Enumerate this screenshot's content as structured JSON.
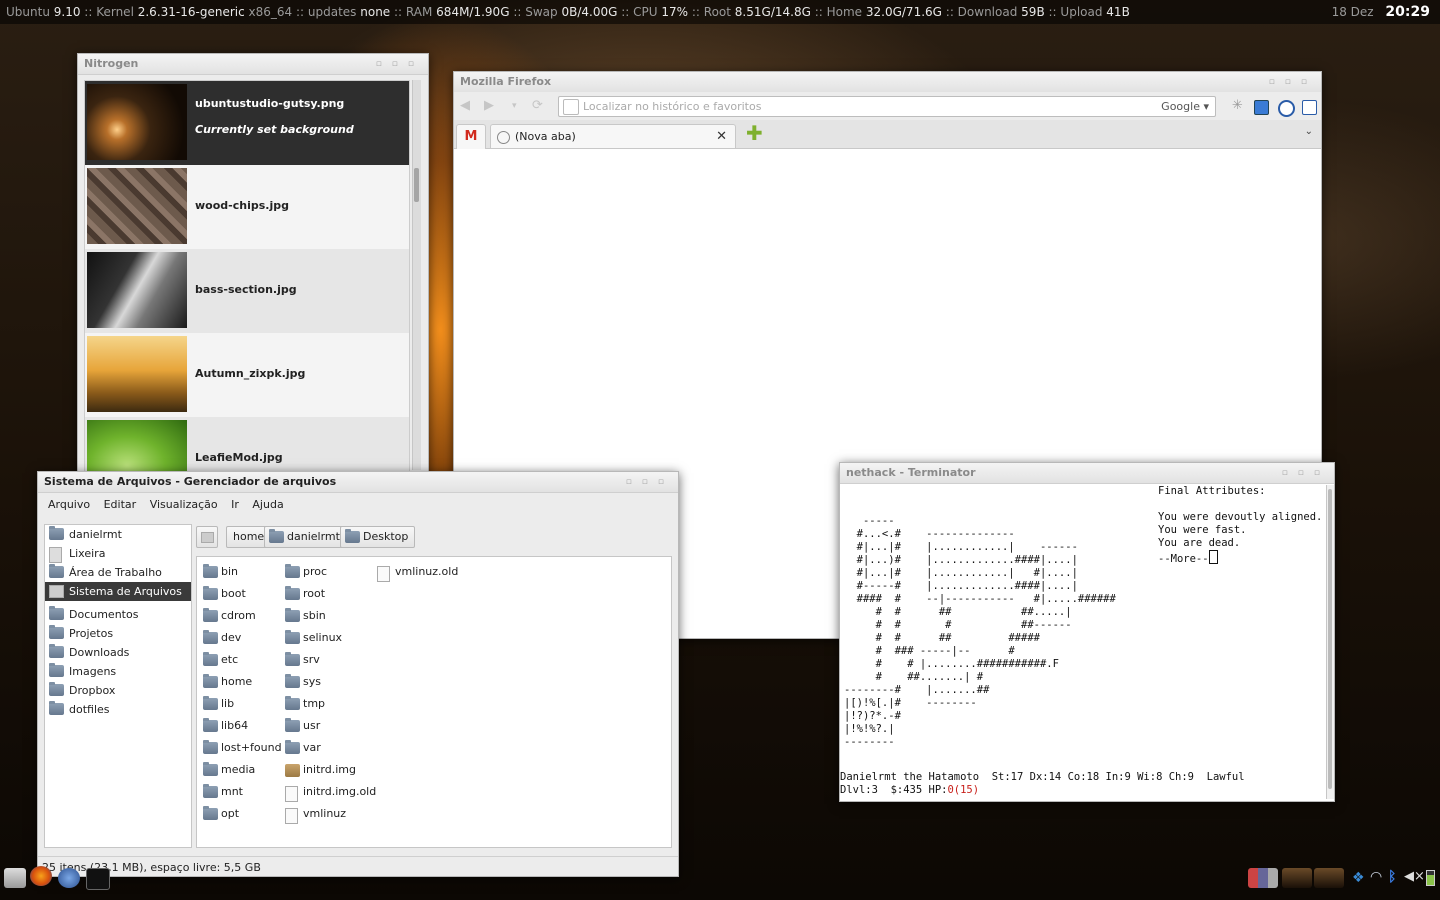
{
  "topbar": {
    "os_label": "Ubuntu",
    "os_version": "9.10",
    "kernel_label": ":: Kernel",
    "kernel": "2.6.31-16-generic",
    "arch": "x86_64",
    "updates_label": ":: updates",
    "updates": "none",
    "ram_label": ":: RAM",
    "ram": "684M/1.90G",
    "swap_label": ":: Swap",
    "swap": "0B/4.00G",
    "cpu_label": ":: CPU",
    "cpu": "17%",
    "root_label": ":: Root",
    "root": "8.51G/14.8G",
    "home_label": ":: Home",
    "home": "32.0G/71.6G",
    "download_label": ":: Download",
    "download": "59B",
    "upload_label": ":: Upload",
    "upload": "41B",
    "date": "18 Dez",
    "time": "20:29"
  },
  "nitrogen": {
    "title": "Nitrogen",
    "items": [
      {
        "name": "ubuntustudio-gutsy.png",
        "status": "Currently set background"
      },
      {
        "name": "wood-chips.jpg"
      },
      {
        "name": "bass-section.jpg"
      },
      {
        "name": "Autumn_zixpk.jpg"
      },
      {
        "name": "LeafieMod.jpg"
      }
    ]
  },
  "firefox": {
    "title": "Mozilla Firefox",
    "url_placeholder": "Localizar no histórico e favoritos",
    "search_engine": "Google",
    "tab_label": "(Nova aba)"
  },
  "filemanager": {
    "title": "Sistema de Arquivos - Gerenciador de arquivos",
    "menu": [
      "Arquivo",
      "Editar",
      "Visualização",
      "Ir",
      "Ajuda"
    ],
    "places": [
      "danielrmt",
      "Lixeira",
      "Área de Trabalho",
      "Sistema de Arquivos"
    ],
    "bookmarks": [
      "Documentos",
      "Projetos",
      "Downloads",
      "Imagens",
      "Dropbox",
      "dotfiles"
    ],
    "path": [
      "home",
      "danielrmt",
      "Desktop"
    ],
    "files_col1": [
      "bin",
      "boot",
      "cdrom",
      "dev",
      "etc",
      "home",
      "lib",
      "lib64",
      "lost+found",
      "media",
      "mnt",
      "opt"
    ],
    "files_col2": [
      "proc",
      "root",
      "sbin",
      "selinux",
      "srv",
      "sys",
      "tmp",
      "usr",
      "var",
      "initrd.img",
      "initrd.img.old",
      "vmlinuz"
    ],
    "files_col3": [
      "vmlinuz.old"
    ],
    "status": "25 itens (23,1 MB), espaço livre: 5,5 GB"
  },
  "terminal": {
    "title": "nethack - Terminator",
    "message": "Final Attributes:\n\nYou were devoutly aligned.\nYou were fast.\nYou are dead.\n--More--",
    "map": "   -----\n  #...<.#    --------------\n  #|...|#    |............|    ------\n  #|...)#    |.............####|....|\n  #|...|#    |............|   #|....|\n  #-----#    |.............####|....|\n  ####  #    --|-----------   #|.....######\n     #  #      ##           ##.....|\n     #  #       #           ##------\n     #  #      ##         #####\n     #  ### -----|--      #\n     #    # |........###########.F\n     #    ##.......| #\n--------#    |.......##\n|[)!%[.|#    --------\n|!?)?*.-#\n|!%!%?.|\n--------",
    "status_line1": "Danielrmt the Hatamoto  St:17 Dx:14 Co:18 In:9 Wi:8 Ch:9  Lawful",
    "status_line2_prefix": "Dlvl:3  $:435 HP:",
    "status_line2_hp": "0(15)"
  }
}
